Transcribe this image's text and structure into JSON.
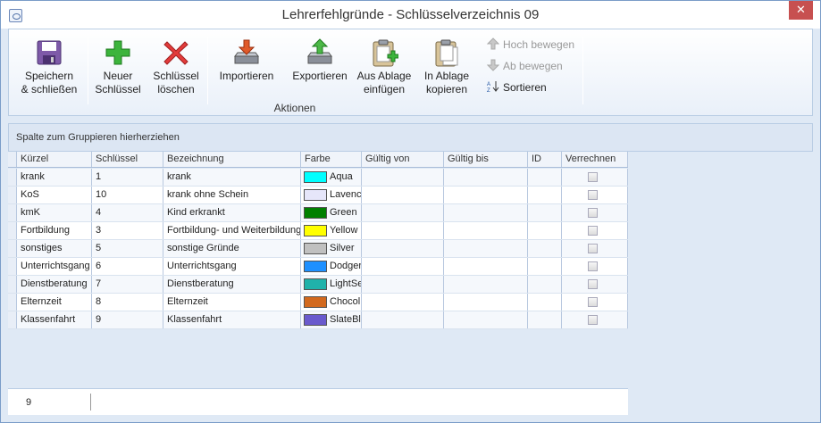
{
  "window": {
    "title": "Lehrerfehlgründe - Schlüsselverzeichnis 09",
    "close_label": "✕"
  },
  "ribbon": {
    "save": "Speichern\n& schließen",
    "new_key": "Neuer\nSchlüssel",
    "delete_key": "Schlüssel\nlöschen",
    "import": "Importieren",
    "export": "Exportieren",
    "paste": "Aus Ablage\neinfügen",
    "copy": "In Ablage\nkopieren",
    "move_up": "Hoch bewegen",
    "move_down": "Ab bewegen",
    "sort": "Sortieren",
    "group_label": "Aktionen"
  },
  "groupbar": {
    "text": "Spalte zum Gruppieren hierherziehen"
  },
  "columns": [
    "Kürzel",
    "Schlüssel",
    "Bezeichnung",
    "Farbe",
    "Gültig von",
    "Gültig bis",
    "ID",
    "Verrechnen"
  ],
  "rows": [
    {
      "kuerzel": "krank",
      "schluessel": "1",
      "bezeichnung": "krank",
      "farbe": "Aqua",
      "color": "#00ffff"
    },
    {
      "kuerzel": "KoS",
      "schluessel": "10",
      "bezeichnung": "krank ohne Schein",
      "farbe": "Lavenc",
      "color": "#e6e6fa"
    },
    {
      "kuerzel": "kmK",
      "schluessel": "4",
      "bezeichnung": "Kind erkrankt",
      "farbe": "Green",
      "color": "#008000"
    },
    {
      "kuerzel": "Fortbildung",
      "schluessel": "3",
      "bezeichnung": "Fortbildung- und Weiterbildung",
      "farbe": "Yellow",
      "color": "#ffff00"
    },
    {
      "kuerzel": "sonstiges",
      "schluessel": "5",
      "bezeichnung": "sonstige Gründe",
      "farbe": "Silver",
      "color": "#c0c0c0"
    },
    {
      "kuerzel": "Unterrichtsgang",
      "schluessel": "6",
      "bezeichnung": "Unterrichtsgang",
      "farbe": "Dodger",
      "color": "#1e90ff"
    },
    {
      "kuerzel": "Dienstberatung",
      "schluessel": "7",
      "bezeichnung": "Dienstberatung",
      "farbe": "LightSe",
      "color": "#20b2aa"
    },
    {
      "kuerzel": "Elternzeit",
      "schluessel": "8",
      "bezeichnung": "Elternzeit",
      "farbe": "Chocol",
      "color": "#d2691e"
    },
    {
      "kuerzel": "Klassenfahrt",
      "schluessel": "9",
      "bezeichnung": "Klassenfahrt",
      "farbe": "SlateBl",
      "color": "#6a5acd"
    }
  ],
  "footer": {
    "count": "9"
  }
}
